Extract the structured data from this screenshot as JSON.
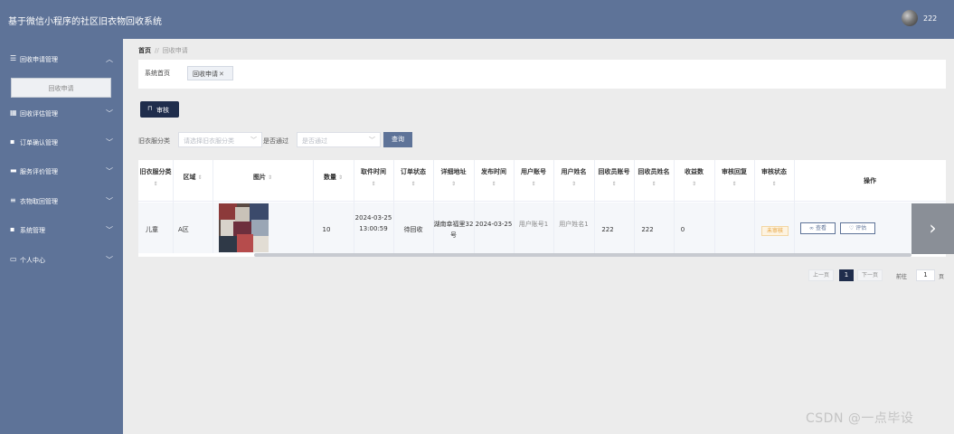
{
  "app": {
    "title": "基于微信小程序的社区旧衣物回收系统",
    "username": "222"
  },
  "sidebar": {
    "items": [
      {
        "label": "回收申请管理",
        "icon": "list-icon",
        "expanded": true
      },
      {
        "label": "回收评估管理",
        "icon": "calendar-icon",
        "expanded": false
      },
      {
        "label": "订单确认管理",
        "icon": "grid-icon",
        "expanded": false
      },
      {
        "label": "服务评价管理",
        "icon": "monitor-icon",
        "expanded": false
      },
      {
        "label": "衣物取回管理",
        "icon": "sliders-icon",
        "expanded": false
      },
      {
        "label": "系统管理",
        "icon": "grid-icon",
        "expanded": false
      },
      {
        "label": "个人中心",
        "icon": "window-icon",
        "expanded": false
      }
    ],
    "submenu": {
      "label": "回收申请"
    }
  },
  "breadcrumb": {
    "home": "首页",
    "sep": "//",
    "current": "回收申请"
  },
  "tabs": [
    {
      "label": "系统首页"
    },
    {
      "label": "回收申请"
    }
  ],
  "toolbar": {
    "audit_label": "审核"
  },
  "filters": [
    {
      "label": "旧衣服分类",
      "placeholder": "请选择旧衣服分类"
    },
    {
      "label": "是否通过",
      "placeholder": "是否通过"
    }
  ],
  "search_label": "查询",
  "table": {
    "columns": [
      {
        "label": "旧衣服分类"
      },
      {
        "label": "区域"
      },
      {
        "label": "图片"
      },
      {
        "label": "数量"
      },
      {
        "label": "取件时间"
      },
      {
        "label": "订单状态"
      },
      {
        "label": "详细地址"
      },
      {
        "label": "发布时间"
      },
      {
        "label": "用户账号"
      },
      {
        "label": "用户姓名"
      },
      {
        "label": "回收员账号"
      },
      {
        "label": "回收员姓名"
      },
      {
        "label": "收益数"
      },
      {
        "label": "审核回复"
      },
      {
        "label": "审核状态"
      },
      {
        "label": "操作"
      }
    ],
    "rows": [
      {
        "category": "儿童",
        "area": "A区",
        "quantity": "10",
        "pickup_time": "2024-03-25 13:00:59",
        "order_status": "待回收",
        "address": "湖南幸福里32号",
        "publish_time": "2024-03-25",
        "user_account": "用户账号1",
        "user_name": "用户姓名1",
        "collector_account": "222",
        "collector_name": "222",
        "earnings": "0",
        "review_reply": "",
        "review_status": "未审核",
        "actions": [
          {
            "label": "查看"
          },
          {
            "label": "评估"
          }
        ]
      }
    ]
  },
  "pagination": {
    "prev": "上一页",
    "current_page": "1",
    "next": "下一页",
    "goto_label": "前往",
    "goto_value": "1",
    "page_suffix": "页"
  },
  "watermark": "CSDN @一点毕设",
  "colors": {
    "sidebar": "#5e7398",
    "primary_dark": "#1f2d4c",
    "warning": "#e6a23c"
  }
}
